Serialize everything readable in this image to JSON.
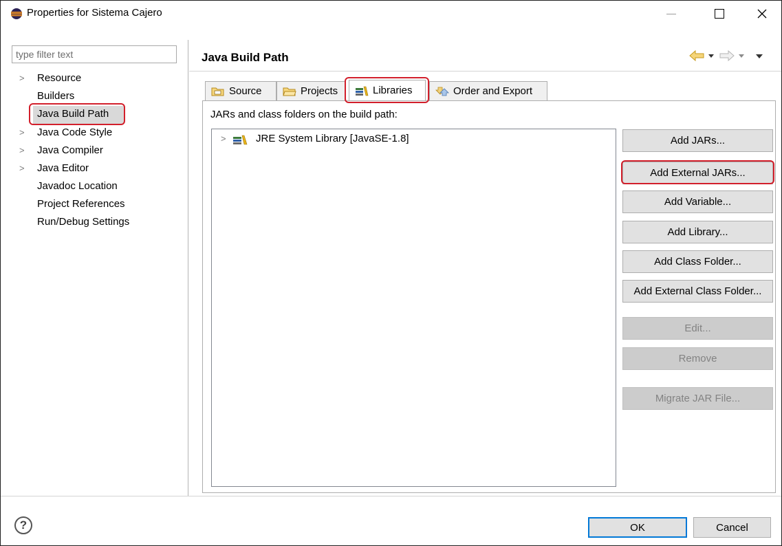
{
  "window": {
    "title": "Properties for Sistema Cajero"
  },
  "filter": {
    "placeholder": "type filter text"
  },
  "sidebar": {
    "items": [
      {
        "label": "Resource",
        "expandable": true
      },
      {
        "label": "Builders",
        "expandable": false
      },
      {
        "label": "Java Build Path",
        "expandable": false,
        "selected": true
      },
      {
        "label": "Java Code Style",
        "expandable": true
      },
      {
        "label": "Java Compiler",
        "expandable": true
      },
      {
        "label": "Java Editor",
        "expandable": true
      },
      {
        "label": "Javadoc Location",
        "expandable": false
      },
      {
        "label": "Project References",
        "expandable": false
      },
      {
        "label": "Run/Debug Settings",
        "expandable": false
      }
    ]
  },
  "page": {
    "title": "Java Build Path",
    "tabs": [
      {
        "label": "Source",
        "icon": "source-folder-icon"
      },
      {
        "label": "Projects",
        "icon": "project-folder-icon"
      },
      {
        "label": "Libraries",
        "icon": "libraries-icon",
        "active": true
      },
      {
        "label": "Order and Export",
        "icon": "order-export-icon"
      }
    ],
    "description": "JARs and class folders on the build path:",
    "tree": [
      {
        "label": "JRE System Library [JavaSE-1.8]",
        "icon": "library-icon"
      }
    ],
    "buttons": [
      {
        "label": "Add JARs...",
        "enabled": true
      },
      {
        "label": "Add External JARs...",
        "enabled": true,
        "highlighted": true
      },
      {
        "label": "Add Variable...",
        "enabled": true
      },
      {
        "label": "Add Library...",
        "enabled": true
      },
      {
        "label": "Add Class Folder...",
        "enabled": true
      },
      {
        "label": "Add External Class Folder...",
        "enabled": true
      },
      {
        "label": "Edit...",
        "enabled": false
      },
      {
        "label": "Remove",
        "enabled": false
      },
      {
        "label": "Migrate JAR File...",
        "enabled": false
      }
    ]
  },
  "footer": {
    "ok_label": "OK",
    "cancel_label": "Cancel"
  },
  "colors": {
    "highlight": "#d21f2b",
    "default_button_border": "#0078d7",
    "disabled_button": "#cccccc"
  }
}
